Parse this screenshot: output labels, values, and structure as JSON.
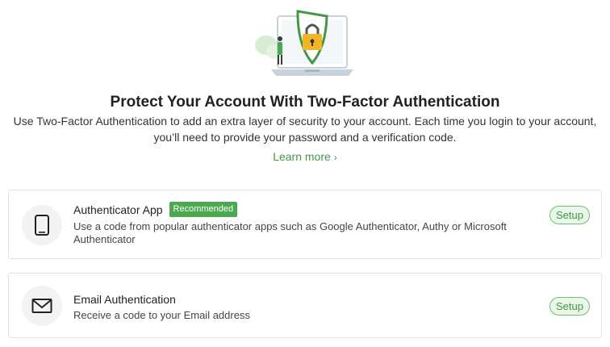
{
  "header": {
    "title": "Protect Your Account With Two-Factor Authentication",
    "subtitle": "Use Two-Factor Authentication to add an extra layer of security to your account. Each time you login to your account, you’ll need to provide your password and a verification code.",
    "learn_more": "Learn more",
    "illustration_icons": [
      "laptop-icon",
      "shield-lock-icon",
      "person-icon"
    ]
  },
  "methods": [
    {
      "title": "Authenticator App",
      "badge": "Recommended",
      "description": "Use a code from popular authenticator apps such as Google Authenticator, Authy or Microsoft Authenticator",
      "action": "Setup",
      "icon": "smartphone-icon"
    },
    {
      "title": "Email Authentication",
      "description": "Receive a code to your Email address",
      "action": "Setup",
      "icon": "envelope-icon"
    }
  ],
  "colors": {
    "accent": "#3f9a42",
    "badge": "#4ca94f",
    "lock": "#f2b526"
  }
}
